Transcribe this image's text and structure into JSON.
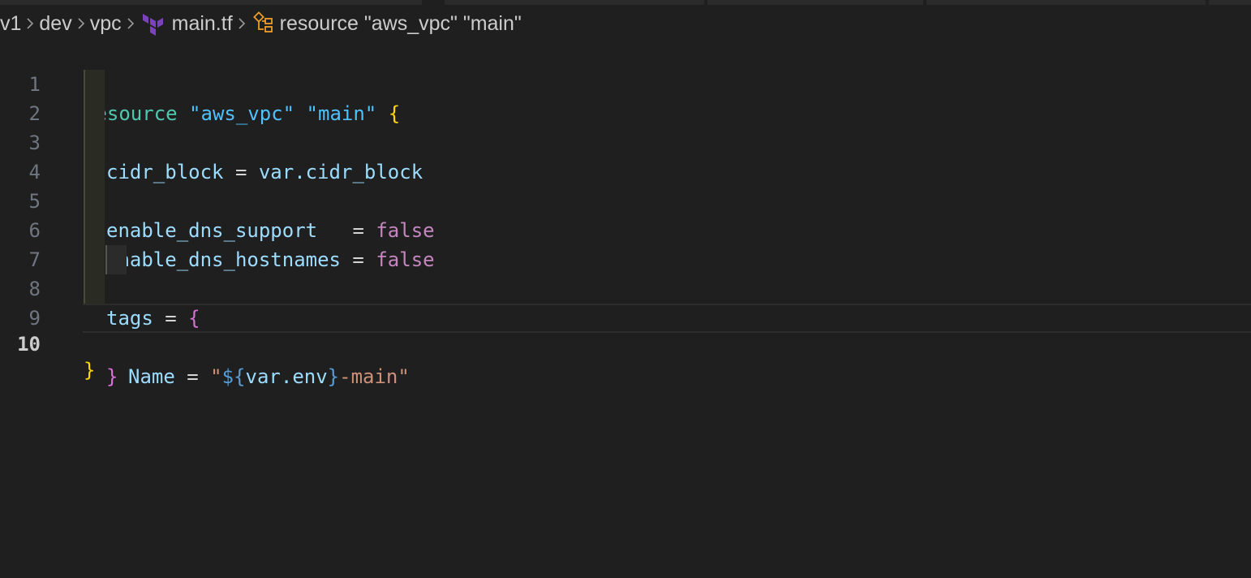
{
  "breadcrumb": {
    "items": [
      "v1",
      "dev",
      "vpc",
      "main.tf",
      "resource \"aws_vpc\" \"main\""
    ]
  },
  "editor": {
    "file": "main.tf",
    "active_line": 10,
    "line_numbers": [
      "1",
      "2",
      "3",
      "4",
      "5",
      "6",
      "7",
      "8",
      "9",
      "10"
    ],
    "tokens": {
      "l1_kw": "resource",
      "l1_type": "\"aws_vpc\"",
      "l1_name": "\"main\"",
      "l1_brace": "{",
      "l2_attr": "cidr_block",
      "l2_eq": " = ",
      "l2_val": "var.cidr_block",
      "l4_attr": "enable_dns_support",
      "l4_eq": "   = ",
      "l4_val": "false",
      "l5_attr": "enable_dns_hostnames",
      "l5_eq": " = ",
      "l5_val": "false",
      "l7_attr": "tags",
      "l7_eq": " = ",
      "l7_brace": "{",
      "l8_attr": "Name",
      "l8_eq": " = ",
      "l8_q1": "\"",
      "l8_interp_open": "${",
      "l8_var": "var.env",
      "l8_interp_close": "}",
      "l8_rest": "-main\"",
      "l9_brace": "}",
      "l10_brace": "}"
    }
  },
  "colors": {
    "background": "#1f1f1f",
    "keyword": "#4ec9b0",
    "string": "#4fc1ff",
    "attribute": "#9cdcfe",
    "boolean": "#c586c0",
    "brace_level1": "#ffd700",
    "brace_level2": "#da70d6",
    "string_literal": "#ce9178"
  },
  "icons": {
    "terraform_file": "terraform-icon",
    "symbol": "symbol-structure-icon",
    "separator": "chevron-right-icon"
  }
}
